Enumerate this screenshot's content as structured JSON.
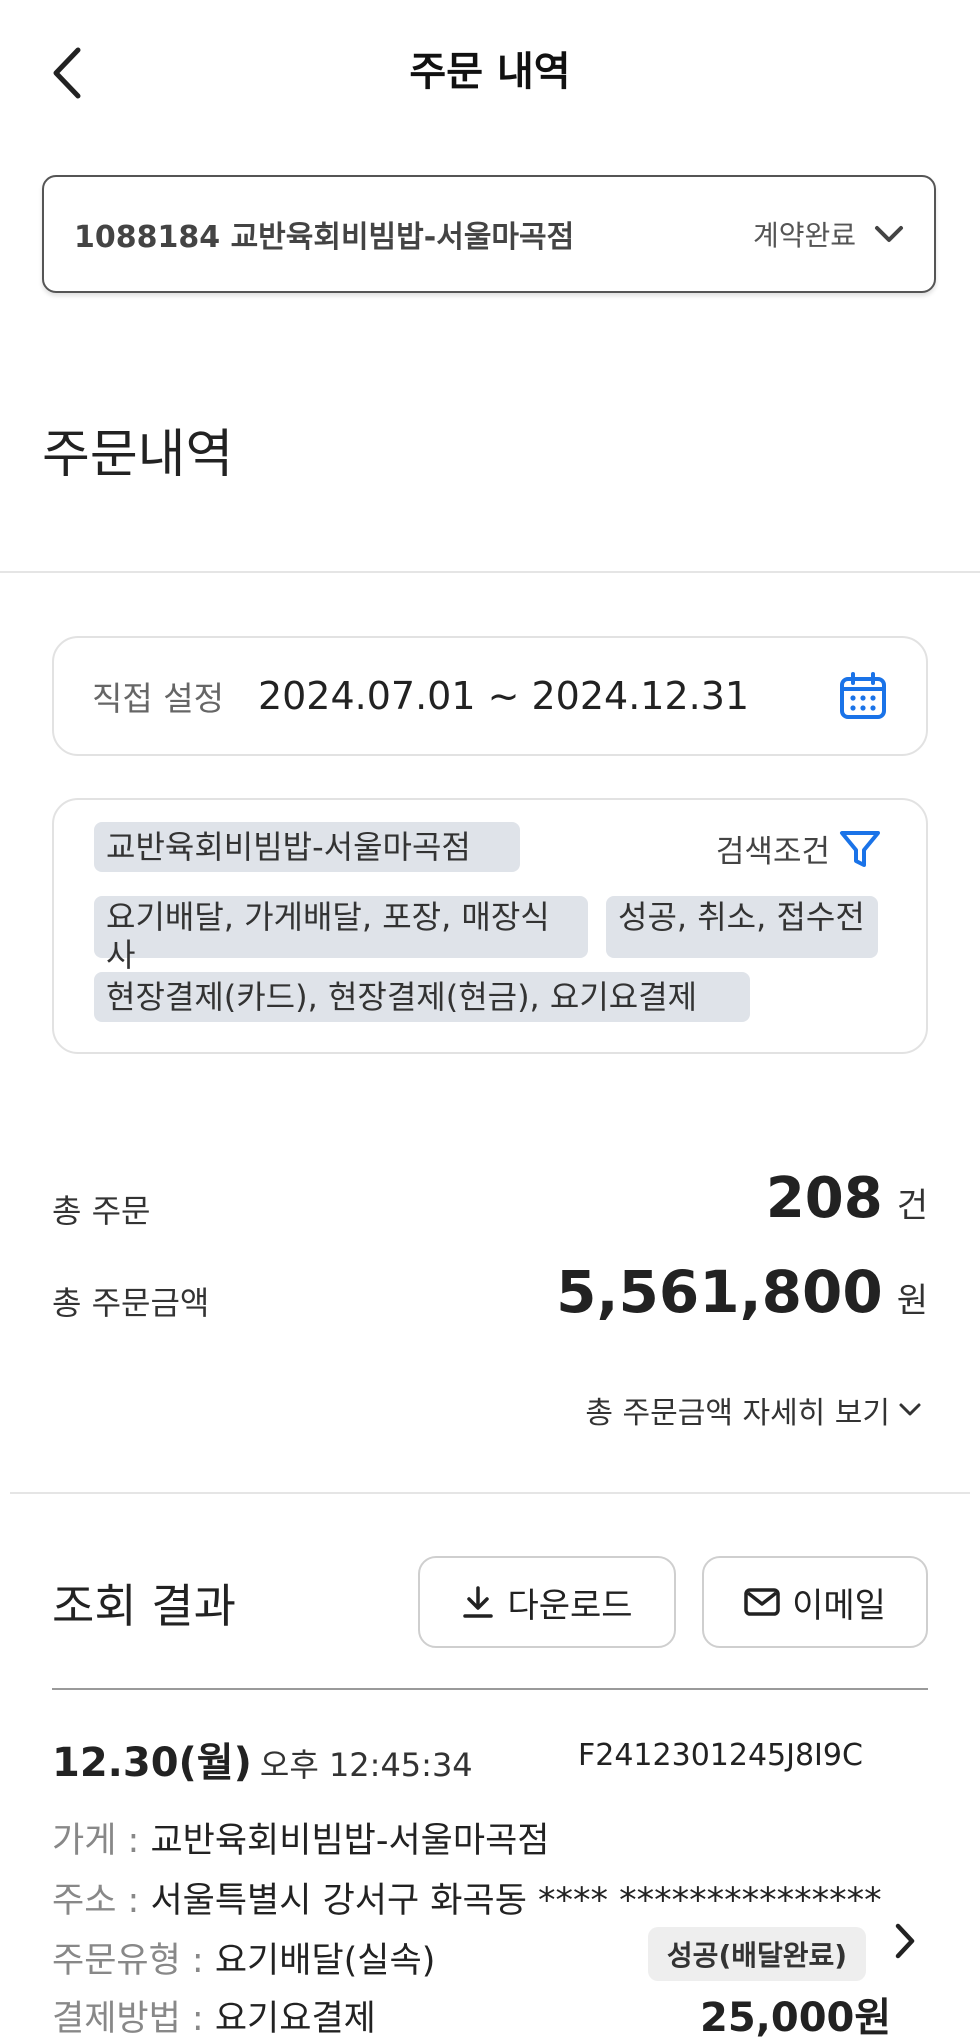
{
  "header": {
    "title": "주문 내역"
  },
  "store_selector": {
    "name": "1088184 교반육회비빔밥-서울마곡점",
    "status": "계약완료"
  },
  "section_title": "주문내역",
  "date_filter": {
    "label": "직접 설정",
    "range": "2024.07.01  ~  2024.12.31"
  },
  "filters": {
    "search_label": "검색조건",
    "store_chip": "교반육회비빔밥-서울마곡점",
    "order_type_chip": "요기배달, 가게배달, 포장, 매장식사",
    "status_chip": "성공, 취소, 접수전",
    "payment_chip": "현장결제(카드), 현장결제(현금), 요기요결제"
  },
  "summary": {
    "total_orders_label": "총 주문",
    "total_orders_value": "208",
    "total_orders_unit": "건",
    "total_amount_label": "총 주문금액",
    "total_amount_value": "5,561,800",
    "total_amount_unit": "원",
    "detail_link": "총 주문금액 자세히 보기"
  },
  "results": {
    "title": "조회 결과",
    "download_label": "다운로드",
    "email_label": "이메일"
  },
  "order": {
    "date": "12.30(월)",
    "time": "오후 12:45:34",
    "id": "F2412301245J8I9C",
    "store_key": "가게 : ",
    "store_value": "교반육회비빔밥-서울마곡점",
    "address_key": "주소 : ",
    "address_value": "서울특별시 강서구 화곡동 **** ***************",
    "type_key": "주문유형 : ",
    "type_value": "요기배달(실속)",
    "status_badge": "성공(배달완료)",
    "payment_key": "결제방법 : ",
    "payment_value": "요기요결제",
    "amount": "25,000원"
  },
  "colors": {
    "accent_blue": "#1a73e8",
    "chip_bg": "#dfe3e9"
  },
  "icons": [
    "back-arrow-icon",
    "chevron-down-icon",
    "calendar-icon",
    "filter-icon",
    "download-icon",
    "mail-icon",
    "chevron-right-icon"
  ]
}
